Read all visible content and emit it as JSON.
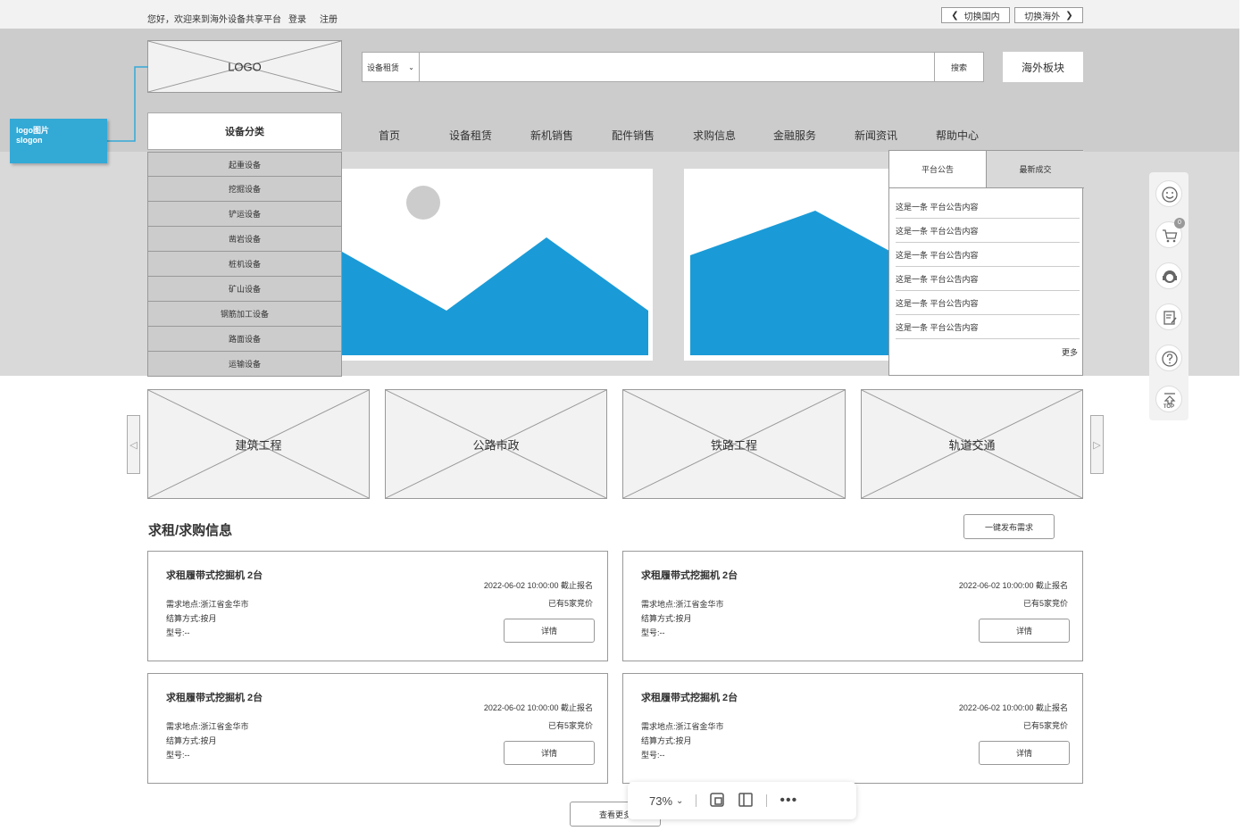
{
  "topbar": {
    "welcome": "您好，欢迎来到海外设备共享平台",
    "login": "登录",
    "register": "注册",
    "switch_domestic": "切换国内",
    "switch_overseas": "切换海外"
  },
  "header": {
    "logo": "LOGO",
    "search_type": "设备租赁",
    "search_button": "搜索",
    "overseas_button": "海外板块"
  },
  "annotation": {
    "line1": "logo图片",
    "line2": "slogon",
    "color": "#33a9d6"
  },
  "nav": {
    "category_title": "设备分类",
    "items": [
      "首页",
      "设备租赁",
      "新机销售",
      "配件销售",
      "求购信息",
      "金融服务",
      "新闻资讯",
      "帮助中心"
    ]
  },
  "categories": [
    "起重设备",
    "挖掘设备",
    "铲运设备",
    "凿岩设备",
    "桩机设备",
    "矿山设备",
    "钢筋加工设备",
    "路面设备",
    "运输设备"
  ],
  "notice_panel": {
    "tabs": [
      "平台公告",
      "最新成交"
    ],
    "items": [
      "这是一条 平台公告内容",
      "这是一条 平台公告内容",
      "这是一条 平台公告内容",
      "这是一条 平台公告内容",
      "这是一条 平台公告内容",
      "这是一条 平台公告内容"
    ],
    "more": "更多"
  },
  "sidebar": {
    "cart_count": "0",
    "top_label": "TOP",
    "icons": [
      "smile-icon",
      "cart-icon",
      "service-icon",
      "edit-icon",
      "help-icon",
      "top-icon"
    ]
  },
  "industries": [
    "建筑工程",
    "公路市政",
    "铁路工程",
    "轨道交通"
  ],
  "demand": {
    "title": "求租/求购信息",
    "publish_button": "一键发布需求",
    "cards": [
      {
        "title": "求租履带式挖掘机 2台",
        "date": "2022-06-02 10:00:00 截止报名",
        "offers": "已有5家竞价",
        "location": "需求地点:浙江省金华市",
        "settle": "结算方式:按月",
        "model": "型号:--",
        "detail": "详情"
      },
      {
        "title": "求租履带式挖掘机 2台",
        "date": "2022-06-02 10:00:00 截止报名",
        "offers": "已有5家竞价",
        "location": "需求地点:浙江省金华市",
        "settle": "结算方式:按月",
        "model": "型号:--",
        "detail": "详情"
      },
      {
        "title": "求租履带式挖掘机 2台",
        "date": "2022-06-02 10:00:00 截止报名",
        "offers": "已有5家竞价",
        "location": "需求地点:浙江省金华市",
        "settle": "结算方式:按月",
        "model": "型号:--",
        "detail": "详情"
      },
      {
        "title": "求租履带式挖掘机 2台",
        "date": "2022-06-02 10:00:00 截止报名",
        "offers": "已有5家竞价",
        "location": "需求地点:浙江省金华市",
        "settle": "结算方式:按月",
        "model": "型号:--",
        "detail": "详情"
      }
    ],
    "more_button": "查看更多"
  },
  "zoom": {
    "level": "73%"
  },
  "colors": {
    "accent": "#1a9bd7",
    "header_bg": "#cccccc"
  }
}
